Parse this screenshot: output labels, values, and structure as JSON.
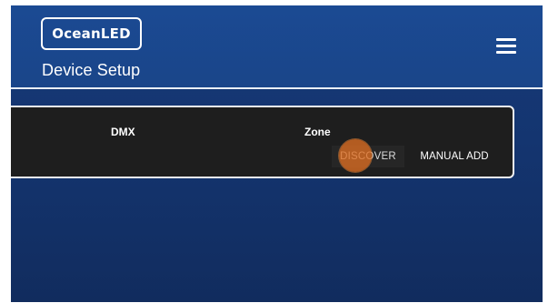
{
  "header": {
    "logo_text": "OceanLED",
    "subtitle": "Device Setup",
    "menu_icon": "hamburger-menu-icon"
  },
  "card": {
    "columns": [
      "DMX",
      "Zone"
    ],
    "buttons": {
      "discover_label": "DISCOVER",
      "manual_add_label": "MANUAL ADD"
    }
  },
  "colors": {
    "header_blue": "#1b4a93",
    "background_blue": "#143570",
    "card_bg": "#1e1e1e",
    "tap_indicator": "#de6e22"
  }
}
